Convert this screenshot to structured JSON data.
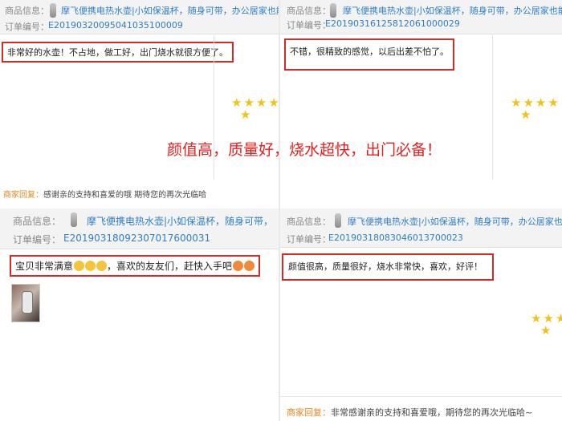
{
  "slogan": "颜值高，质量好，烧水超快，出门必备！",
  "colors": {
    "accent_red": "#d32a2a",
    "link_blue": "#2f7fc8",
    "star_gold": "#f2c21a",
    "reply_orange": "#e7871f"
  },
  "reviews": [
    {
      "product_label": "商品信息：",
      "product_name": "摩飞便携电热水壶|小如保温杯，随身可带，办公居家也能用",
      "order_label": "订单编号：",
      "order_no": "E20190320095041035100009",
      "comment": "非常好的水壶！不占地，做工好，出门烧水就很方便了。",
      "rating": 5
    },
    {
      "product_label": "商品信息：",
      "product_name": "摩飞便携电热水壶|小如保温杯，随身可带，办公居家也能用",
      "order_label": "订单编号：",
      "order_no": "E20190316125812061000029",
      "comment": "不错，很精致的感觉，以后出差不怕了。",
      "rating": 5
    },
    {
      "product_label": "商品信息：",
      "product_name": "摩飞便携电热水壶|小如保温杯，随身可带，",
      "order_label": "订单编号：",
      "order_no": "E20190318092307017600031",
      "comment": "宝贝非常满意",
      "comment_tail": "，喜欢的友友们，赶快入手吧",
      "rating": 5
    },
    {
      "product_label": "商品信息：",
      "product_name": "摩飞便携电热水壶|小如保温杯，随身可带，办公居家也能",
      "order_label": "订单编号：",
      "order_no": "E20190318083046013700023",
      "comment": "颜值很高，质量很好，烧水非常快，喜欢，好评！",
      "rating": 5
    }
  ],
  "replies": [
    {
      "label": "商家回复：",
      "text": "感谢亲的支持和喜爱的哦 期待您的再次光临哈"
    },
    {
      "label": "商家回复：",
      "text": "非常感谢亲的支持和喜爱哦，期待您的再次光临哈~"
    }
  ]
}
